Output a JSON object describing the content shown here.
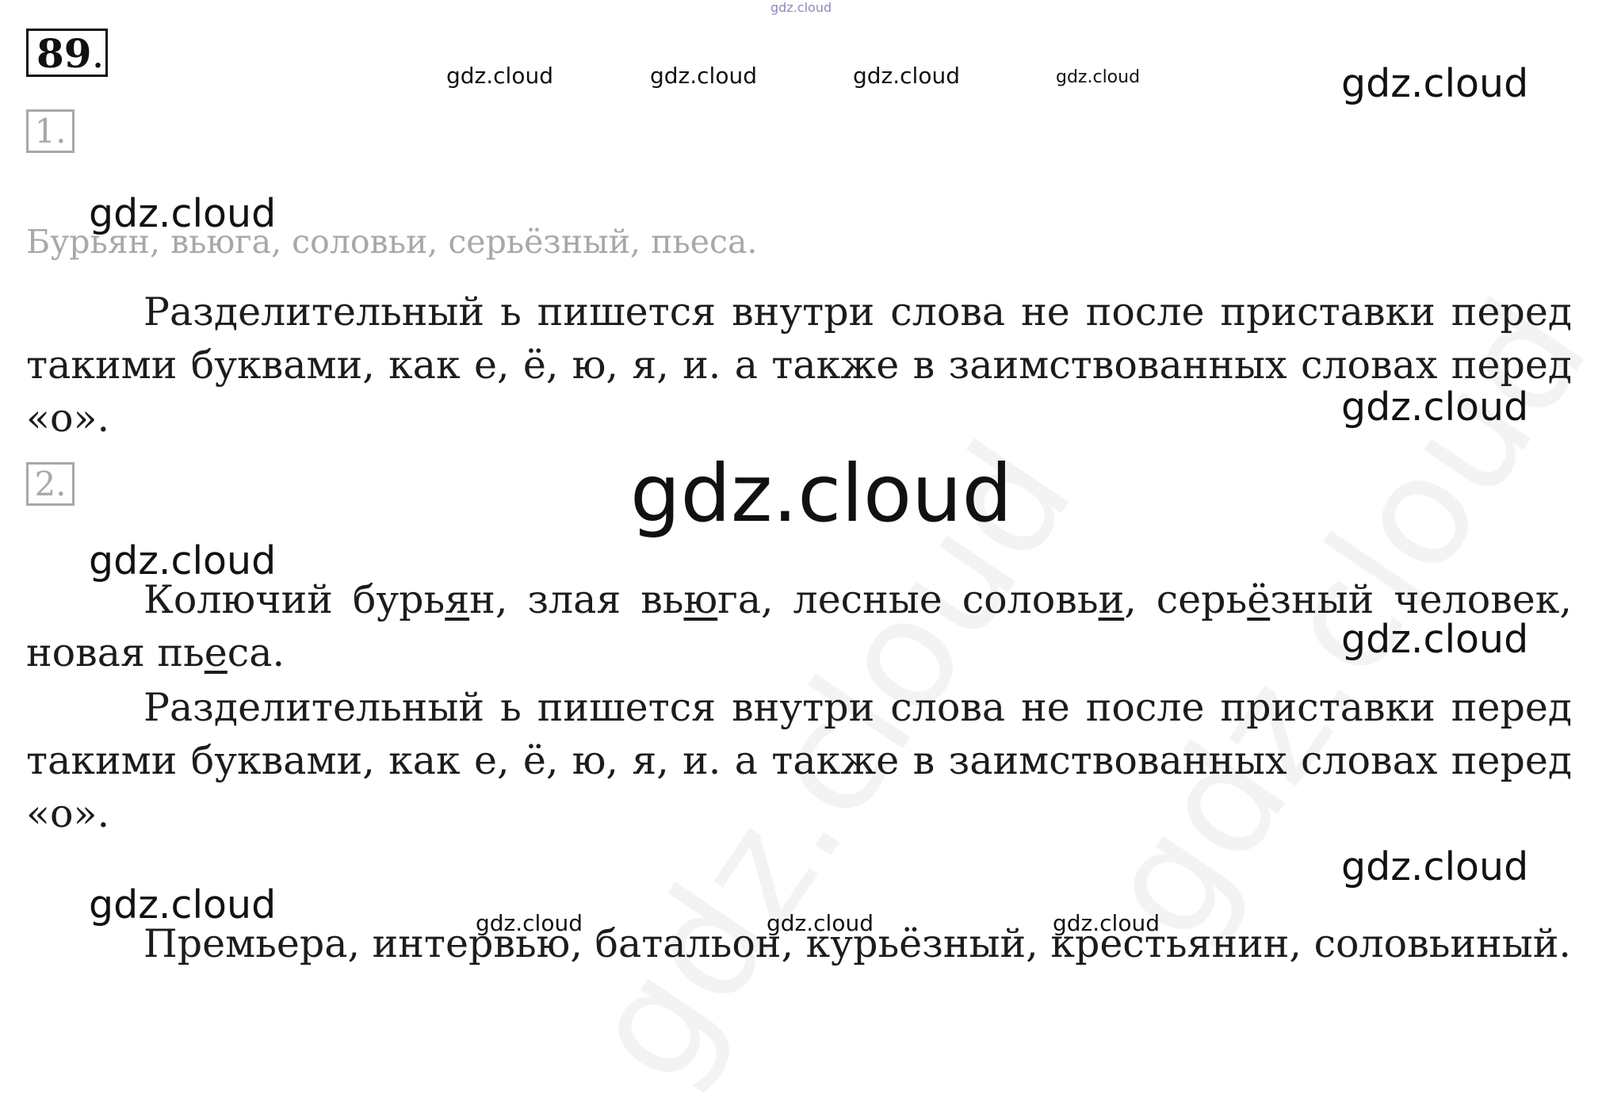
{
  "task_number": "89",
  "watermark": "gdz.cloud",
  "section1": {
    "label": "1.",
    "words": "Бурьян, вьюга, соловьи, серьёзный, пьеса.",
    "rule": "Разделительный ь пишется внутри слова не после приставки перед такими буквами, как е, ё, ю, я, и. а также в заимствованных словах перед «о»."
  },
  "section2": {
    "label": "2.",
    "phrase": {
      "p1": "Колючий бурь",
      "u1": "я",
      "p2": "н, злая вь",
      "u2": "ю",
      "p3": "га, лесные соловь",
      "u3": "и",
      "p4": ", серь",
      "u4": "ё",
      "p5": "зный человек, новая пь",
      "u5": "е",
      "p6": "са."
    },
    "rule": "Разделительный ь пишется внутри слова не после приставки перед такими буквами, как е, ё, ю, я, и. а также в заимствованных словах перед «о»."
  },
  "section3": {
    "words": "Премьера, интервью, батальон, курьёзный, крестьянин, соловьиный."
  }
}
